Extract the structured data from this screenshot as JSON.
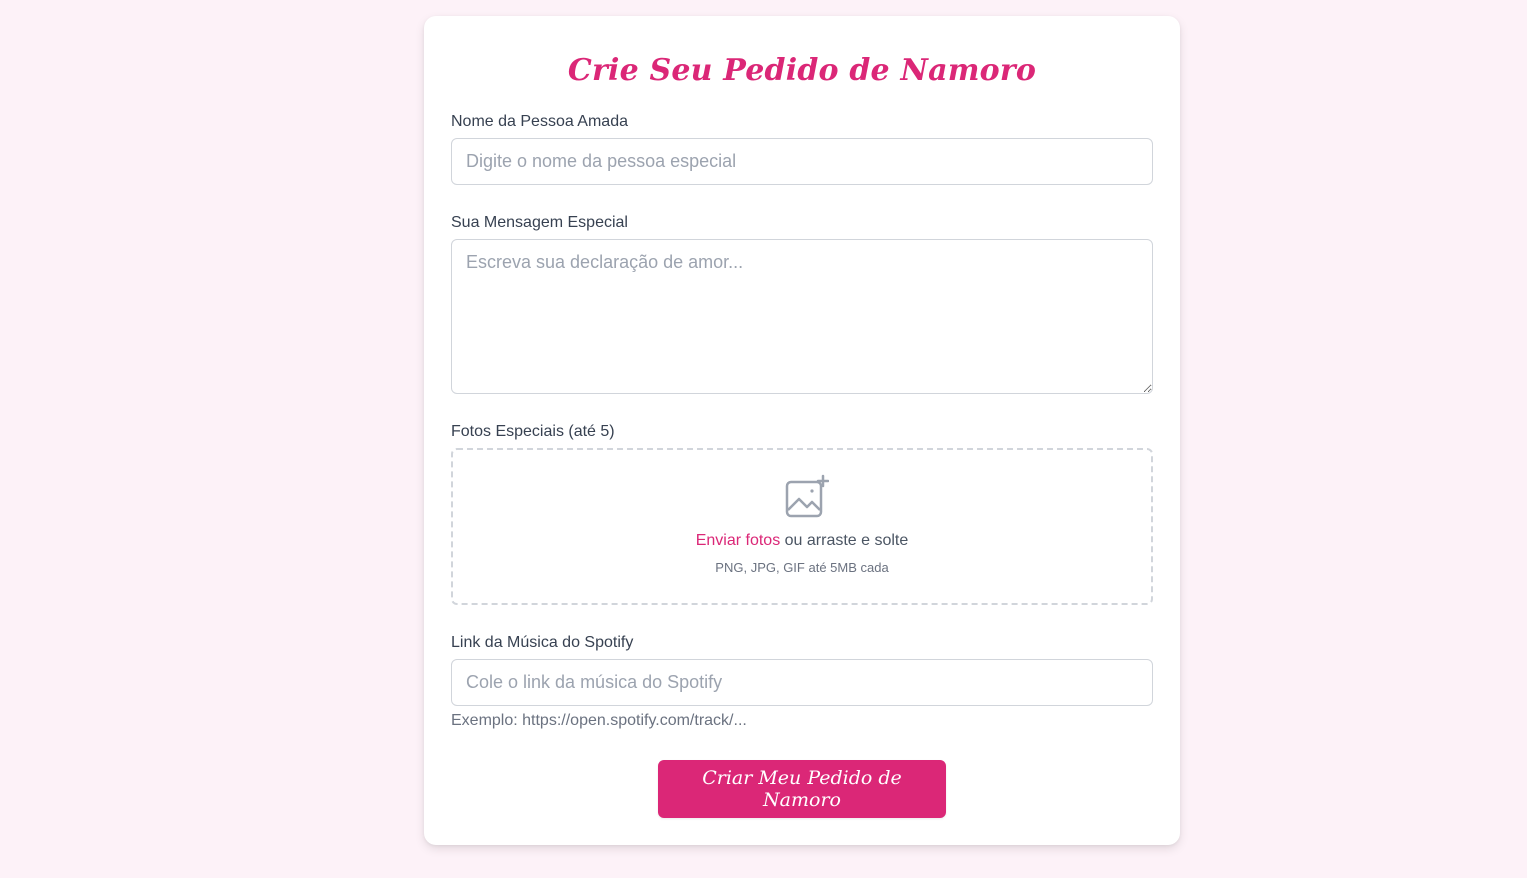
{
  "form": {
    "title": "Crie Seu Pedido de Namoro",
    "name_field": {
      "label": "Nome da Pessoa Amada",
      "value": "",
      "placeholder": "Digite o nome da pessoa especial"
    },
    "message_field": {
      "label": "Sua Mensagem Especial",
      "value": "",
      "placeholder": "Escreva sua declaração de amor..."
    },
    "photos_field": {
      "label": "Fotos Especiais (até 5)",
      "upload_link": "Enviar fotos",
      "upload_text": " ou arraste e solte",
      "hint": "PNG, JPG, GIF até 5MB cada",
      "icon": "image-plus-icon"
    },
    "spotify_field": {
      "label": "Link da Música do Spotify",
      "value": "",
      "placeholder": "Cole o link da música do Spotify",
      "helper": "Exemplo: https://open.spotify.com/track/..."
    },
    "submit_label": "Criar Meu Pedido de Namoro"
  },
  "colors": {
    "page_background": "#fdf2f8",
    "accent": "#db2777",
    "border": "#d1d5db",
    "placeholder": "#9ca3af"
  }
}
